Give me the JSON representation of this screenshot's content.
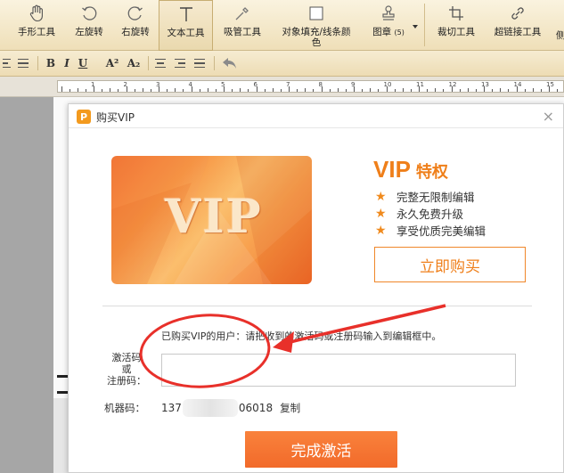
{
  "toolbar": {
    "tools": [
      {
        "label": "手形工具",
        "icon": "hand-icon"
      },
      {
        "label": "左旋转",
        "icon": "rotate-left-icon"
      },
      {
        "label": "右旋转",
        "icon": "rotate-right-icon"
      },
      {
        "label": "文本工具",
        "icon": "text-tool-icon",
        "active": true
      },
      {
        "label": "吸管工具",
        "icon": "eyedropper-icon"
      },
      {
        "label": "对象填充/线条颜色",
        "icon": "fill-color-icon"
      },
      {
        "label": "图章",
        "icon": "stamp-icon",
        "count": "(5)"
      },
      {
        "label": "裁切工具",
        "icon": "crop-icon"
      },
      {
        "label": "超链接工具",
        "icon": "hyperlink-icon"
      }
    ],
    "fill_color_label_line1": "对象填充/线条颜",
    "fill_color_label_line2": "色",
    "stamp_label": "图章",
    "stamp_count": "(5)"
  },
  "format_bar": {
    "bold": "B",
    "italic": "I",
    "underline": "U",
    "superscript": "A²",
    "subscript": "A₂"
  },
  "ruler": {
    "numbers": [
      "1",
      "2",
      "3",
      "4",
      "5",
      "6",
      "7",
      "8",
      "9",
      "10",
      "11",
      "12",
      "13",
      "14",
      "15"
    ]
  },
  "dialog": {
    "title": "购买VIP",
    "logo_letter": "P",
    "close": "×",
    "card_text": "VIP",
    "heading_main": "VIP",
    "heading_sub": "特权",
    "benefits": [
      "完整无限制编辑",
      "永久免费升级",
      "享受优质完美编辑"
    ],
    "buy_button": "立即购买",
    "instruction": "已购买VIP的用户：请把收到的激活码或注册码输入到编辑框中。",
    "code_label_line1": "激活码",
    "code_label_line2": "或",
    "code_label_line3": "注册码：",
    "code_value": "",
    "machine_label": "机器码：",
    "machine_code_prefix": "137",
    "machine_code_suffix": "06018",
    "copy_link": "复制",
    "activate_button": "完成激活"
  },
  "colors": {
    "accent": "#ef7f1a",
    "activate": "#f26a2a",
    "annotation": "#e8302a"
  }
}
